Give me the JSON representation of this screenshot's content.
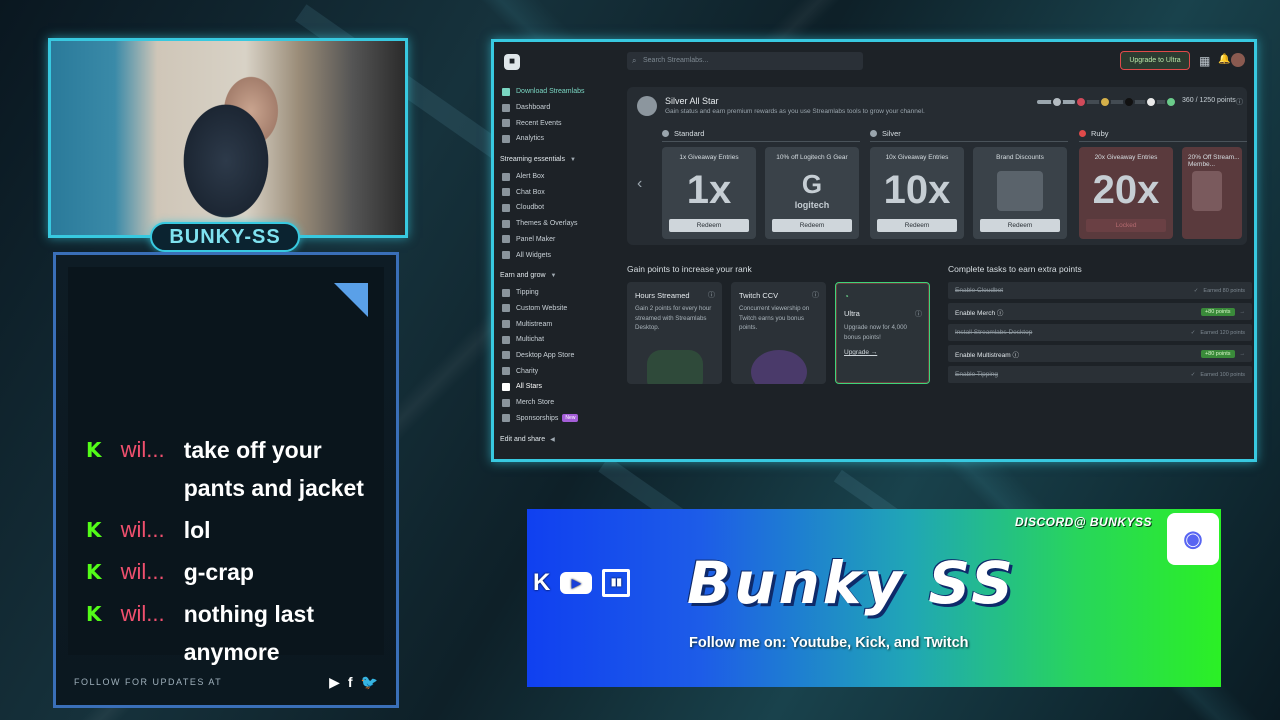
{
  "webcam": {
    "name_tag": "BUNKY-SS"
  },
  "chat": {
    "messages": [
      {
        "user": "wil...",
        "text": "take off your pants and jacket"
      },
      {
        "user": "wil...",
        "text": "lol"
      },
      {
        "user": "wil...",
        "text": "g-crap"
      },
      {
        "user": "wil...",
        "text": "nothing last anymore"
      }
    ],
    "footer_text": "FOLLOW FOR UPDATES AT",
    "socials": [
      "youtube-icon",
      "facebook-icon",
      "twitter-icon"
    ]
  },
  "streamlabs": {
    "search_placeholder": "Search Streamlabs...",
    "upgrade_button": "Upgrade to Ultra",
    "sidebar": {
      "top_items": [
        "Download Streamlabs",
        "Dashboard",
        "Recent Events",
        "Analytics"
      ],
      "section1": "Streaming essentials",
      "section1_items": [
        "Alert Box",
        "Chat Box",
        "Cloudbot",
        "Themes & Overlays",
        "Panel Maker",
        "All Widgets"
      ],
      "section2": "Earn and grow",
      "section2_items": [
        "Tipping",
        "Custom Website",
        "Multistream",
        "Multichat",
        "Desktop App Store",
        "Charity",
        "All Stars",
        "Merch Store",
        "Sponsorships"
      ],
      "new_badge": "New",
      "section3": "Edit and share"
    },
    "allstar": {
      "title": "Silver All Star",
      "subtitle": "Gain status and earn premium rewards as you use Streamlabs tools to grow your channel.",
      "points": "360 / 1250 points",
      "progress_fraction": 0.29,
      "tiers": [
        "Standard",
        "Silver",
        "Ruby"
      ],
      "cards": [
        {
          "title": "1x Giveaway Entries",
          "big": "1x",
          "button": "Redeem"
        },
        {
          "title": "10% off Logitech G Gear",
          "big": "logitech",
          "button": "Redeem"
        },
        {
          "title": "10x Giveaway Entries",
          "big": "10x",
          "button": "Redeem"
        },
        {
          "title": "Brand Discounts",
          "big": "",
          "button": "Redeem"
        },
        {
          "title": "20x Giveaway Entries",
          "big": "20x",
          "button": "Locked"
        },
        {
          "title": "20% Off Stream... Membe...",
          "big": "",
          "button": ""
        }
      ]
    },
    "gain_title": "Gain points to increase your rank",
    "rank_cards": [
      {
        "title": "Hours Streamed",
        "desc": "Gain 2 points for every hour streamed with Streamlabs Desktop."
      },
      {
        "title": "Twitch CCV",
        "desc": "Concurrent viewership on Twitch earns you bonus points."
      },
      {
        "title": "Ultra",
        "desc": "Upgrade now for 4,000 bonus points!",
        "link": "Upgrade"
      }
    ],
    "tasks_title": "Complete tasks to earn extra points",
    "tasks": [
      {
        "label": "Enable Cloudbot",
        "status": "Earned 80 points",
        "done": true
      },
      {
        "label": "Enable Merch",
        "status": "+80 points",
        "done": false
      },
      {
        "label": "Install Streamlabs Desktop",
        "status": "Earned 120 points",
        "done": true
      },
      {
        "label": "Enable Multistream",
        "status": "+80 points",
        "done": false
      },
      {
        "label": "Enable Tipping",
        "status": "Earned 100 points",
        "done": true
      }
    ]
  },
  "banner": {
    "title": "Bunky SS",
    "follow": "Follow me on: Youtube, Kick, and Twitch",
    "discord": "DISCORD@ BUNKYSS"
  },
  "colors": {
    "accent": "#38c9e0",
    "kick_green": "#53fc18",
    "chat_user": "#f0506e"
  }
}
